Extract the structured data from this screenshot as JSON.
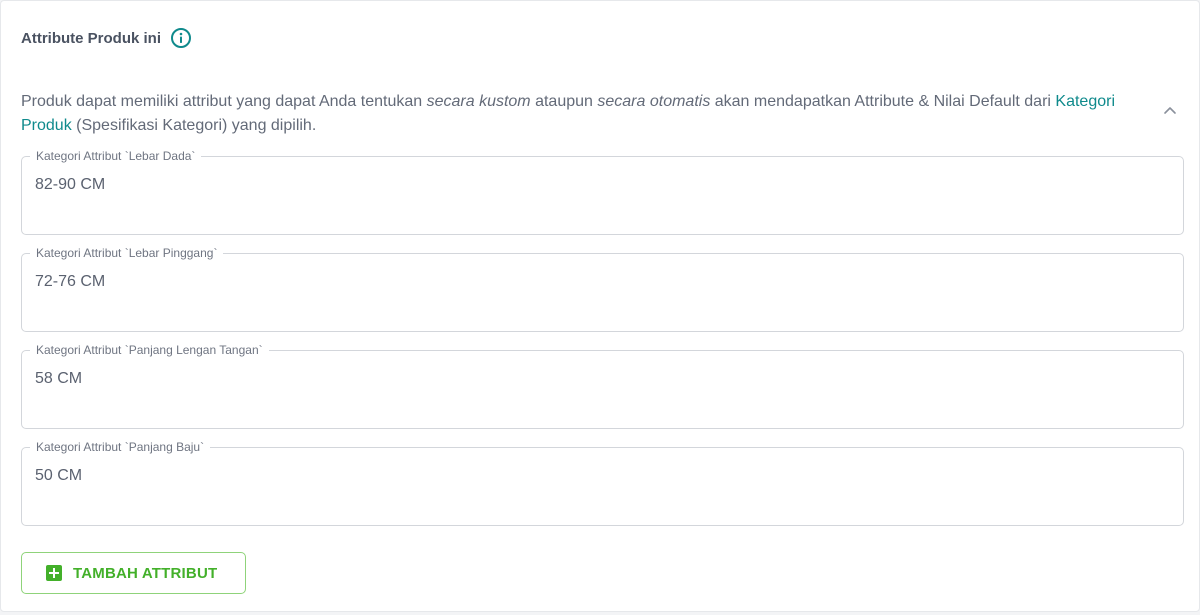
{
  "header": {
    "title": "Attribute Produk ini",
    "info_icon": "info-circle-icon"
  },
  "description": {
    "part1": "Produk dapat memiliki attribut yang dapat Anda tentukan ",
    "emph1": "secara kustom",
    "part2": " ataupun ",
    "emph2": "secara otomatis",
    "part3": " akan mendapatkan Attribute & Nilai Default dari ",
    "link": "Kategori Produk",
    "part4": " (Spesifikasi Kategori) yang dipilih."
  },
  "collapse_icon": "chevron-up-icon",
  "fields": [
    {
      "label": "Kategori Attribut `Lebar Dada`",
      "value": "82-90 CM"
    },
    {
      "label": "Kategori Attribut `Lebar Pinggang`",
      "value": "72-76 CM"
    },
    {
      "label": "Kategori Attribut `Panjang Lengan Tangan`",
      "value": "58 CM"
    },
    {
      "label": "Kategori Attribut `Panjang Baju`",
      "value": "50 CM"
    }
  ],
  "add_button": {
    "label": "TAMBAH ATTRIBUT",
    "icon": "plus-square-icon"
  },
  "colors": {
    "accent_teal": "#0f8a8c",
    "accent_green": "#43b02a",
    "border": "#d3d6db"
  }
}
